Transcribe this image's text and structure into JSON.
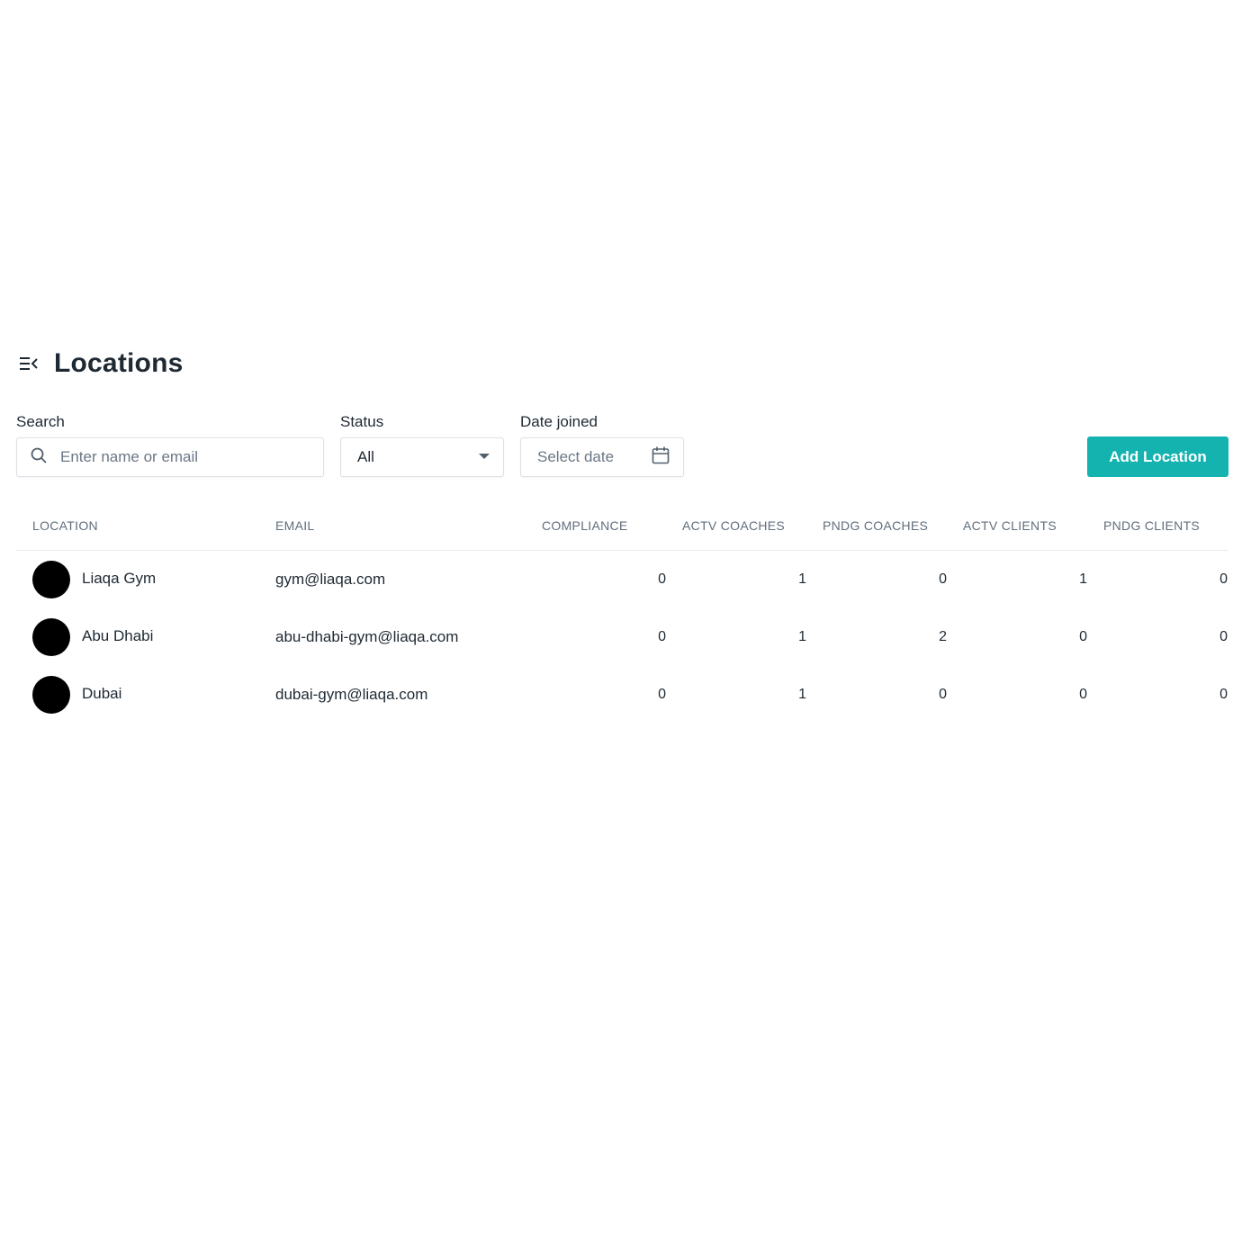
{
  "header": {
    "title": "Locations",
    "menu_icon": "menu-collapse-icon"
  },
  "filters": {
    "search": {
      "label": "Search",
      "placeholder": "Enter name or email",
      "value": "",
      "icon": "search-icon"
    },
    "status": {
      "label": "Status",
      "value": "All",
      "icon": "caret-down-icon"
    },
    "date_joined": {
      "label": "Date joined",
      "placeholder": "Select date",
      "icon": "calendar-icon"
    }
  },
  "actions": {
    "add_location_label": "Add Location",
    "accent_color": "#14b3b0"
  },
  "table": {
    "columns": [
      "LOCATION",
      "EMAIL",
      "COMPLIANCE",
      "ACTV COACHES",
      "PNDG COACHES",
      "ACTV CLIENTS",
      "PNDG CLIENTS"
    ],
    "rows": [
      {
        "location": "Liaqa Gym",
        "email": "gym@liaqa.com",
        "compliance": "0",
        "actv_coaches": "1",
        "pndg_coaches": "0",
        "actv_clients": "1",
        "pndg_clients": "0"
      },
      {
        "location": "Abu Dhabi",
        "email": "abu-dhabi-gym@liaqa.com",
        "compliance": "0",
        "actv_coaches": "1",
        "pndg_coaches": "2",
        "actv_clients": "0",
        "pndg_clients": "0"
      },
      {
        "location": "Dubai",
        "email": "dubai-gym@liaqa.com",
        "compliance": "0",
        "actv_coaches": "1",
        "pndg_coaches": "0",
        "actv_clients": "0",
        "pndg_clients": "0"
      }
    ]
  }
}
